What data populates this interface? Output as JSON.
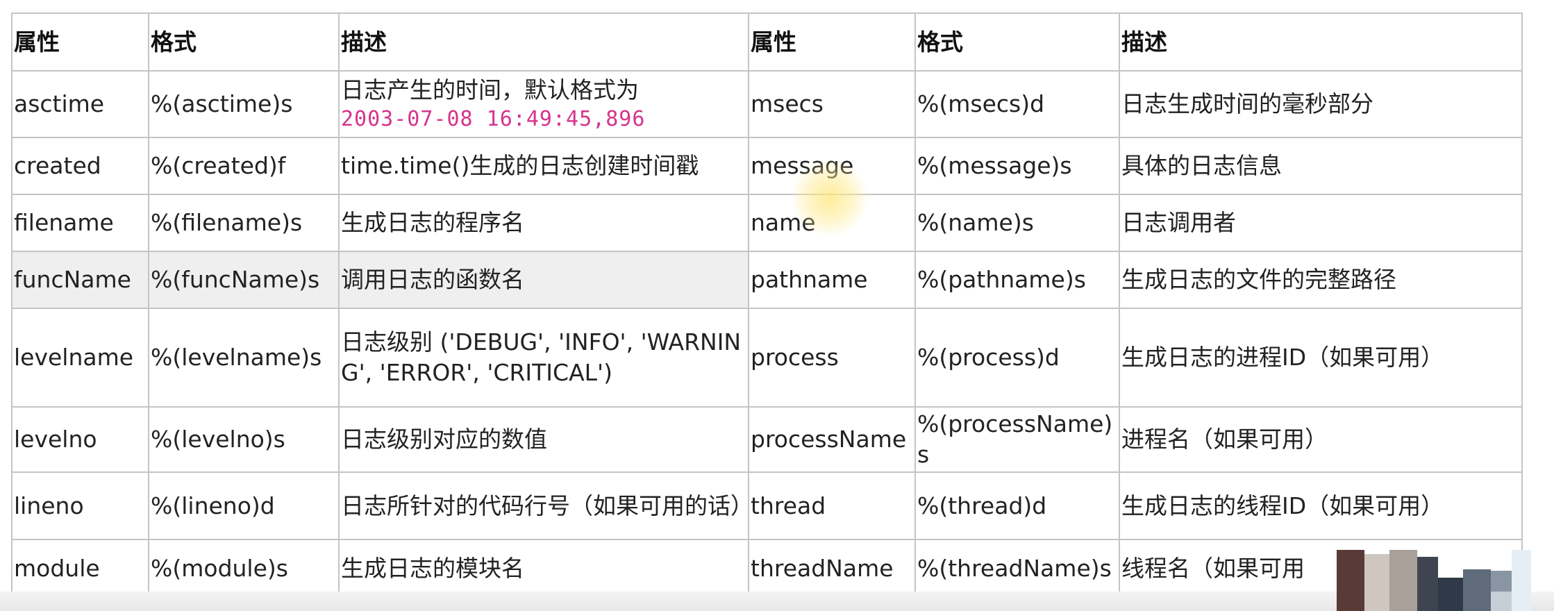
{
  "headers": [
    "属性",
    "格式",
    "描述",
    "属性",
    "格式",
    "描述"
  ],
  "rows": [
    {
      "attr1": "asctime",
      "fmt1": "%(asctime)s",
      "desc1": "日志产生的时间，默认格式为",
      "desc1_code": "2003-07-08 16:49:45,896",
      "attr2": "msecs",
      "fmt2": "%(msecs)d",
      "desc2": "日志生成时间的毫秒部分"
    },
    {
      "attr1": "created",
      "fmt1": "%(created)f",
      "desc1": "time.time()生成的日志创建时间戳",
      "attr2": "message",
      "fmt2": "%(message)s",
      "desc2": "具体的日志信息"
    },
    {
      "attr1": "filename",
      "fmt1": "%(filename)s",
      "desc1": "生成日志的程序名",
      "attr2": "name",
      "fmt2": "%(name)s",
      "desc2": "日志调用者"
    },
    {
      "attr1": "funcName",
      "fmt1": "%(funcName)s",
      "desc1": "调用日志的函数名",
      "attr2": "pathname",
      "fmt2": "%(pathname)s",
      "desc2": "生成日志的文件的完整路径"
    },
    {
      "attr1": "levelname",
      "fmt1": "%(levelname)s",
      "desc1": "日志级别 ('DEBUG', 'INFO', 'WARNING', 'ERROR', 'CRITICAL')",
      "attr2": "process",
      "fmt2": "%(process)d",
      "desc2": "生成日志的进程ID（如果可用）"
    },
    {
      "attr1": "levelno",
      "fmt1": "%(levelno)s",
      "desc1": "日志级别对应的数值",
      "attr2": "processName",
      "fmt2": "%(processName)s",
      "desc2": "进程名（如果可用）"
    },
    {
      "attr1": "lineno",
      "fmt1": "%(lineno)d",
      "desc1": "日志所针对的代码行号（如果可用的话）",
      "attr2": "thread",
      "fmt2": "%(thread)d",
      "desc2": "生成日志的线程ID（如果可用）"
    },
    {
      "attr1": "module",
      "fmt1": "%(module)s",
      "desc1": "生成日志的模块名",
      "attr2": "threadName",
      "fmt2": "%(threadName)s",
      "desc2": "线程名（如果可用"
    }
  ],
  "colors": {
    "border": "#c4c4c4",
    "code_text": "#d6338c",
    "row_highlight": "#efefef",
    "cursor_highlight": "#ffe678"
  }
}
